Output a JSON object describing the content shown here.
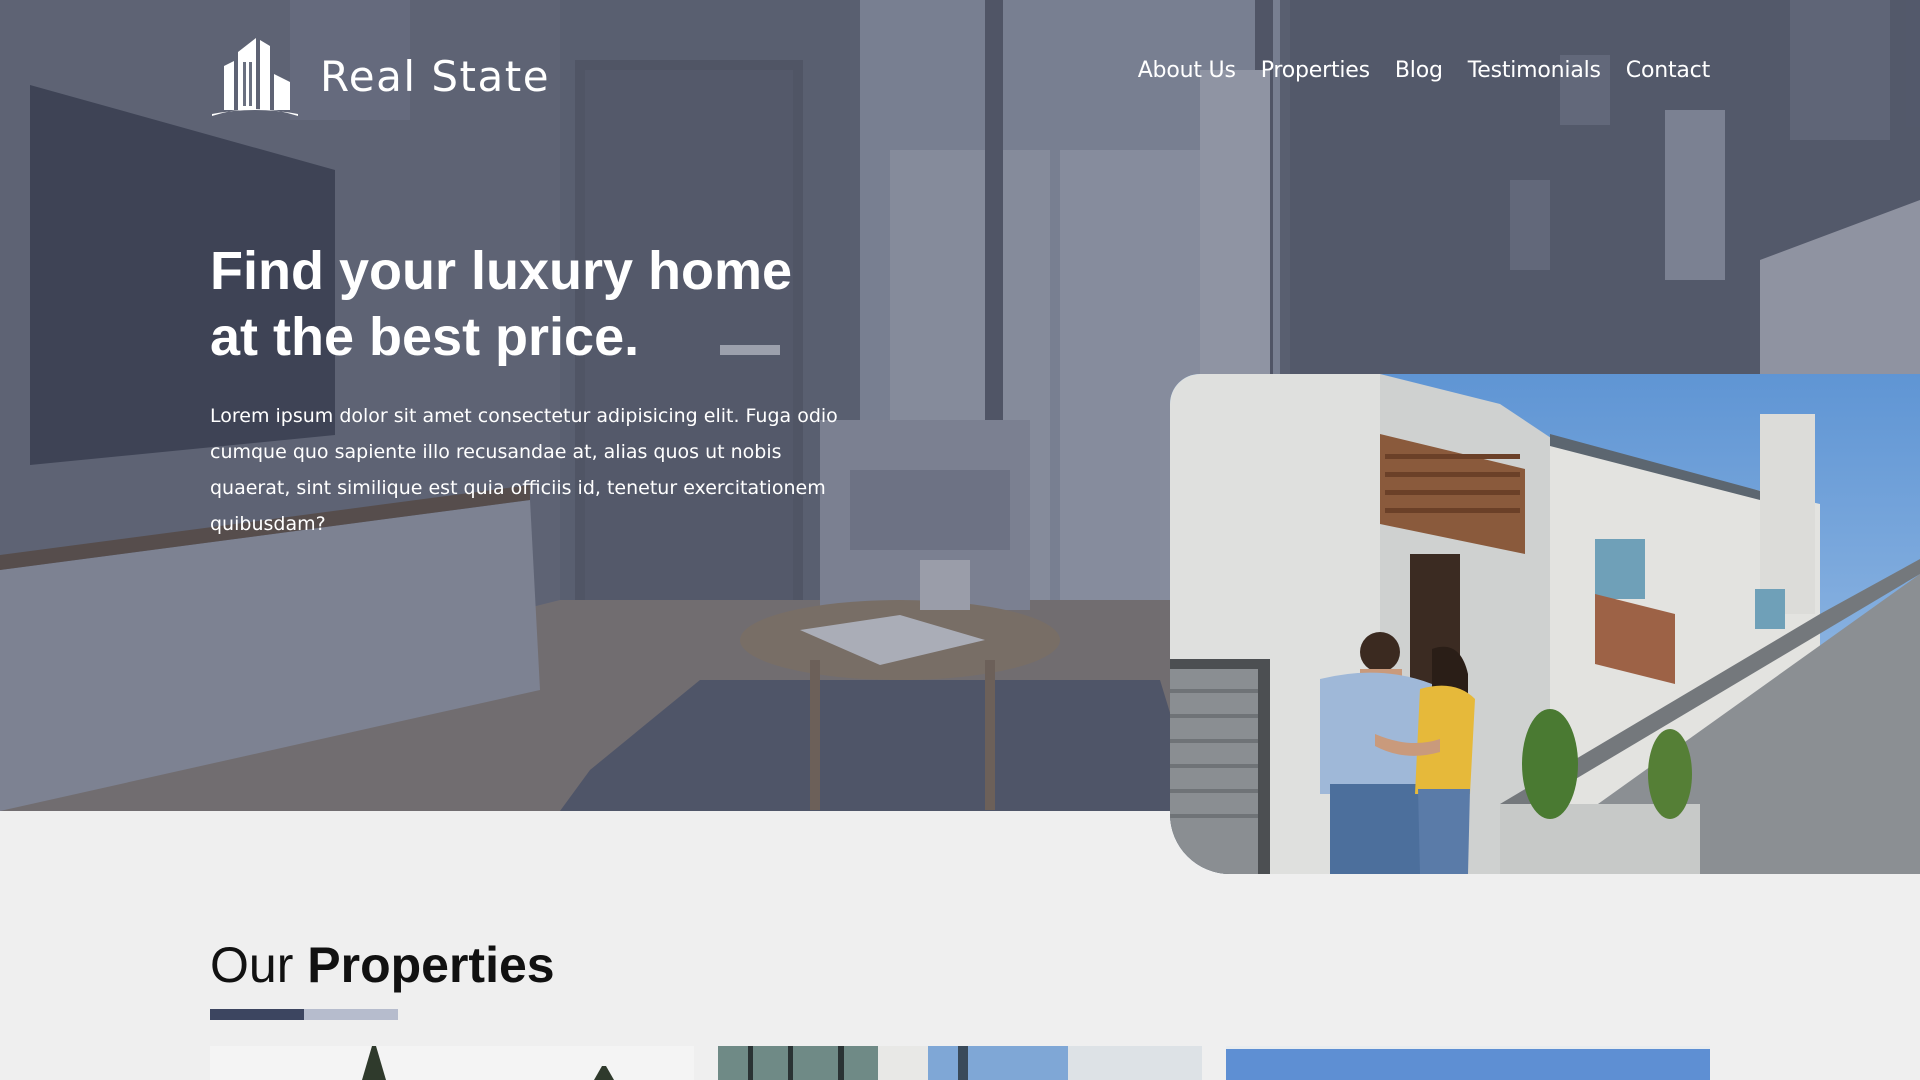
{
  "brand": {
    "name": "Real State",
    "logo_icon": "buildings-icon",
    "colors": {
      "accent_dark": "#3c4560",
      "accent_light": "#b6bccd",
      "page_bg": "#efefef"
    }
  },
  "nav": {
    "items": [
      {
        "label": "About Us"
      },
      {
        "label": "Properties"
      },
      {
        "label": "Blog"
      },
      {
        "label": "Testimonials"
      },
      {
        "label": "Contact"
      }
    ]
  },
  "hero": {
    "title": "Find your luxury home at the best price.",
    "description": "Lorem ipsum dolor sit amet consectetur adipisicing elit. Fuga odio cumque quo sapiente illo recusandae at, alias quos ut nobis quaerat, sint similique est quia officiis id, tenetur exercitationem quibusdam?"
  },
  "properties": {
    "title_light": "Our",
    "title_bold": "Properties",
    "cards": [
      {
        "image": "property-photo-1"
      },
      {
        "image": "property-photo-2"
      },
      {
        "image": "property-photo-3"
      }
    ]
  }
}
